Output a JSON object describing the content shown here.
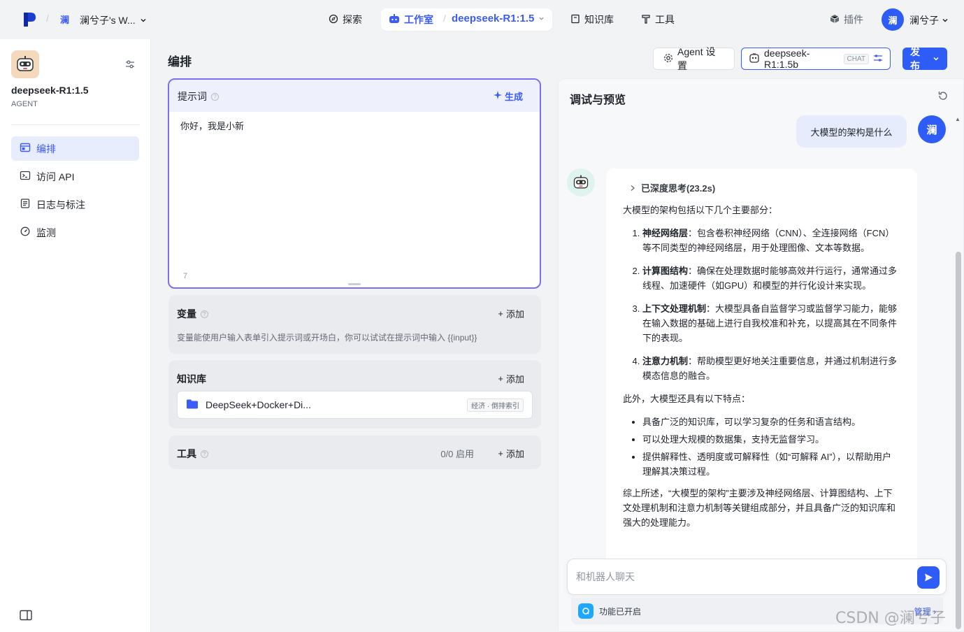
{
  "topbar": {
    "workspace_avatar": "澜",
    "workspace_name": "澜兮子's W...",
    "nav_explore": "探索",
    "nav_studio": "工作室",
    "nav_model": "deepseek-R1:1.5",
    "nav_knowledge": "知识库",
    "nav_tools": "工具",
    "plugins": "插件",
    "user_avatar": "澜",
    "user_name": "澜兮子"
  },
  "sidebar": {
    "bot_name": "deepseek-R1:1.5",
    "bot_type": "AGENT",
    "items": [
      {
        "label": "编排",
        "icon": "layout-icon"
      },
      {
        "label": "访问 API",
        "icon": "terminal-icon"
      },
      {
        "label": "日志与标注",
        "icon": "log-icon"
      },
      {
        "label": "监测",
        "icon": "gauge-icon"
      }
    ]
  },
  "main": {
    "title": "编排",
    "agent_settings": "Agent 设置",
    "model_name": "deepseek-R1:1.5b",
    "model_tag": "CHAT",
    "publish": "发布"
  },
  "prompt": {
    "label": "提示词",
    "generate": "生成",
    "value": "你好，我是小新",
    "count": "7"
  },
  "variables": {
    "title": "变量",
    "add": "添加",
    "desc": "变量能使用户输入表单引入提示词或开场白，你可以试试在提示词中输入 {{input}}"
  },
  "knowledge": {
    "title": "知识库",
    "add": "添加",
    "item_name": "DeepSeek+Docker+Di...",
    "item_tag": "经济 · 倒排索引"
  },
  "tools": {
    "title": "工具",
    "status": "0/0 启用",
    "add": "添加"
  },
  "preview": {
    "title": "调试与预览",
    "user_message": "大模型的架构是什么",
    "user_avatar": "澜",
    "thinking": "已深度思考(23.2s)",
    "intro": "大模型的架构包括以下几个主要部分：",
    "points": [
      {
        "title": "神经网络层",
        "text": "：包含卷积神经网络（CNN）、全连接网络（FCN）等不同类型的神经网络层，用于处理图像、文本等数据。"
      },
      {
        "title": "计算图结构",
        "text": "：确保在处理数据时能够高效并行运行，通常通过多线程、加速硬件（如GPU）和模型的并行化设计来实现。"
      },
      {
        "title": "上下文处理机制",
        "text": "：大模型具备自监督学习或监督学习能力，能够在输入数据的基础上进行自我校准和补充，以提高其在不同条件下的表现。"
      },
      {
        "title": "注意力机制",
        "text": "：帮助模型更好地关注重要信息，并通过机制进行多模态信息的融合。"
      }
    ],
    "features_intro": "此外，大模型还具有以下特点：",
    "features": [
      "具备广泛的知识库，可以学习复杂的任务和语言结构。",
      "可以处理大规模的数据集，支持无监督学习。",
      "提供解释性、透明度或可解释性（如“可解释 AI”），以帮助用户理解其决策过程。"
    ],
    "summary": "综上所述，“大模型的架构”主要涉及神经网络层、计算图结构、上下文处理机制和注意力机制等关键组成部分，并且具备广泛的知识库和强大的处理能力。",
    "input_placeholder": "和机器人聊天",
    "feature_status": "功能已开启",
    "feature_manage": "管理"
  },
  "watermark": "CSDN @澜兮子"
}
